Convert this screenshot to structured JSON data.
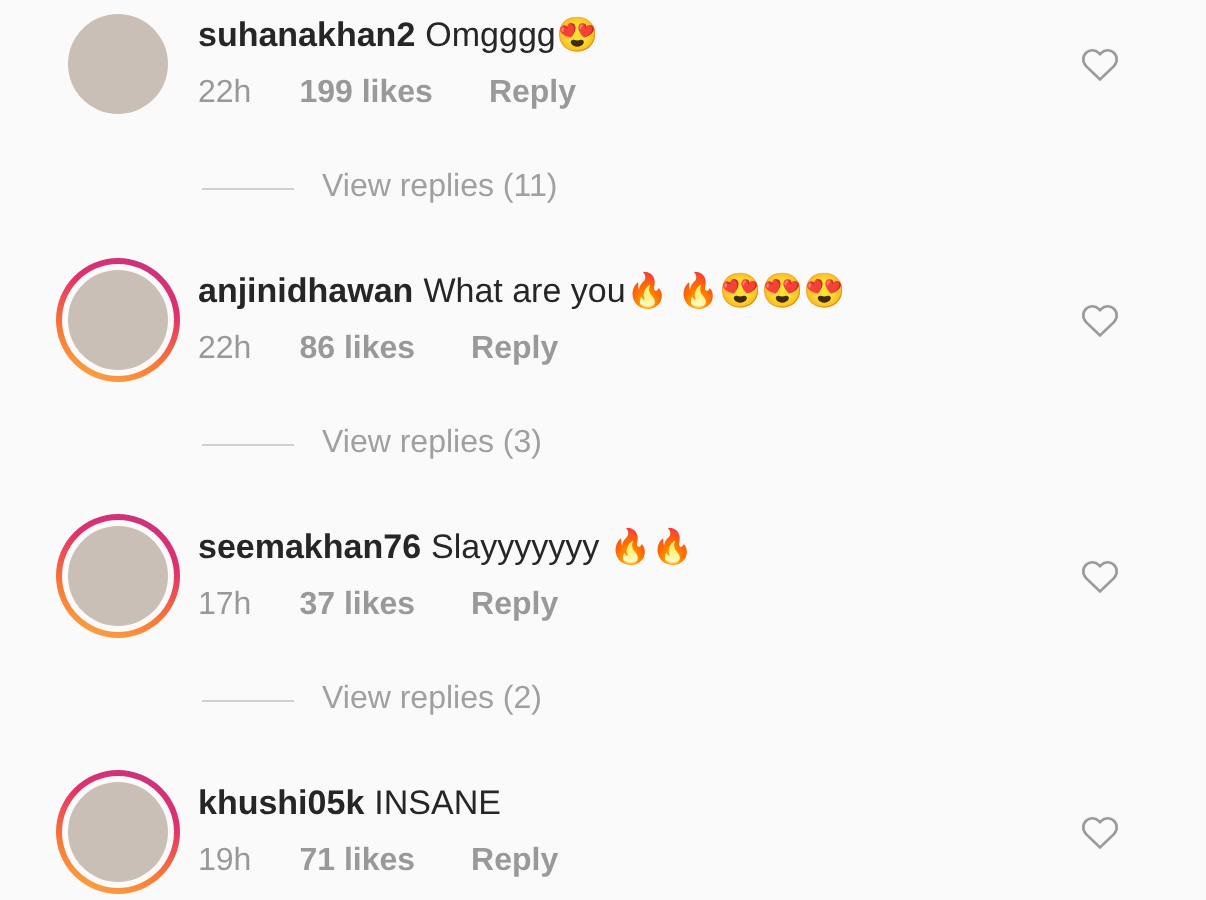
{
  "comments": [
    {
      "username": "suhanakhan2",
      "text": "Omgggg😍",
      "time": "22h",
      "likes": "199 likes",
      "reply": "Reply",
      "story_ring": false,
      "view_replies": "View replies (11)"
    },
    {
      "username": "anjinidhawan",
      "text": "What are you🔥 🔥😍😍😍",
      "time": "22h",
      "likes": "86 likes",
      "reply": "Reply",
      "story_ring": true,
      "view_replies": "View replies (3)"
    },
    {
      "username": "seemakhan76",
      "text": "Slayyyyyyy 🔥🔥",
      "time": "17h",
      "likes": "37 likes",
      "reply": "Reply",
      "story_ring": true,
      "view_replies": "View replies (2)"
    },
    {
      "username": "khushi05k",
      "text": "INSANE",
      "time": "19h",
      "likes": "71 likes",
      "reply": "Reply",
      "story_ring": true
    }
  ]
}
